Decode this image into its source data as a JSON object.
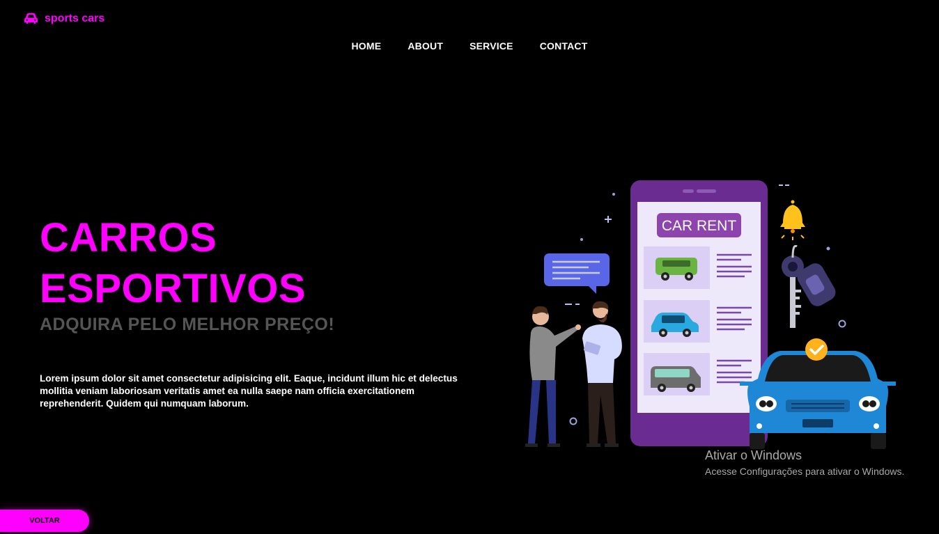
{
  "brand": {
    "name": "sports cars",
    "icon": "car-icon",
    "color": "#ff00ff"
  },
  "nav": {
    "items": [
      "HOME",
      "ABOUT",
      "SERVICE",
      "CONTACT"
    ]
  },
  "hero": {
    "title_line1": "CARROS",
    "title_line2": "ESPORTIVOS",
    "subtitle": "ADQUIRA PELO MELHOR PREÇO!",
    "text": "Lorem ipsum dolor sit amet consectetur adipisicing elit. Eaque, incidunt illum hic et delectus mollitia veniam laboriosam veritatis amet ea nulla saepe nam officia exercitationem reprehenderit. Quidem qui numquam laborum."
  },
  "illustration": {
    "banner": "CAR RENT"
  },
  "watermark": {
    "line1": "Ativar o Windows",
    "line2": "Acesse Configurações para ativar o Windows."
  },
  "back_button": {
    "label": "VOLTAR"
  }
}
